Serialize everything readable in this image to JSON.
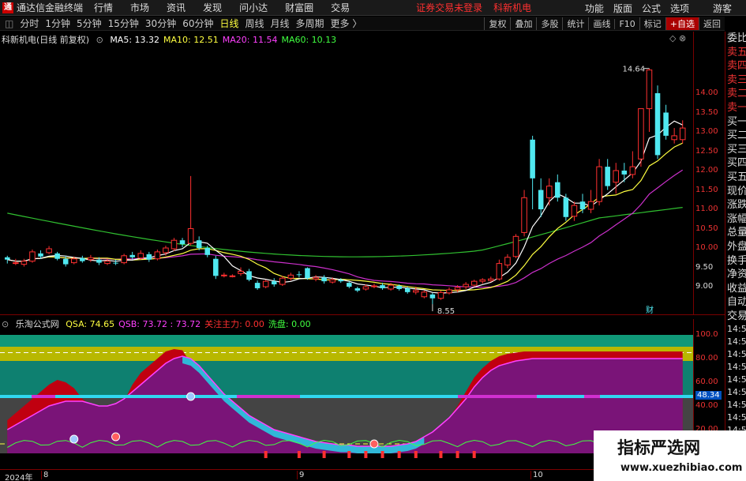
{
  "menubar": {
    "logo": "通",
    "app_title": "通达信金融终端",
    "items": [
      "行情",
      "市场",
      "资讯",
      "发现",
      "问小达",
      "财富圈",
      "交易"
    ],
    "warn": "证券交易未登录",
    "stock": "科新机电",
    "right": [
      "功能",
      "版面",
      "公式",
      "选项",
      "游客"
    ]
  },
  "periodbar": {
    "periods": [
      "分时",
      "1分钟",
      "5分钟",
      "15分钟",
      "30分钟",
      "60分钟",
      "日线",
      "周线",
      "月线",
      "多周期",
      "更多 〉"
    ],
    "active": "日线",
    "tools": [
      "复权",
      "叠加",
      "多股",
      "统计",
      "画线",
      "F10",
      "标记",
      "+自选",
      "返回"
    ]
  },
  "main": {
    "stock_label": "科新机电(日线 前复权)",
    "ma": [
      {
        "name": "MA5",
        "value": "13.32",
        "color": "#ffffff"
      },
      {
        "name": "MA10",
        "value": "12.51",
        "color": "#ffff40"
      },
      {
        "name": "MA20",
        "value": "11.54",
        "color": "#ff40ff"
      },
      {
        "name": "MA60",
        "value": "10.13",
        "color": "#40ff40"
      }
    ],
    "high_label": "14.64",
    "low_label": "8.55",
    "fin_mark": "财",
    "y_ticks": [
      "14.00",
      "13.50",
      "13.00",
      "12.50",
      "12.00",
      "11.50",
      "11.00",
      "10.50",
      "10.00",
      "9.50",
      "9.00"
    ]
  },
  "indicator": {
    "name": "乐淘公式网",
    "items": [
      {
        "text": "QSA: 74.65",
        "color": "#ffff40"
      },
      {
        "text": "QSB: 73.72 : 73.72",
        "color": "#ff40ff"
      },
      {
        "text": "关注主力: 0.00",
        "color": "#ff3030"
      },
      {
        "text": "洗盘: 0.00",
        "color": "#40ff40"
      }
    ],
    "y_ticks": [
      "100.0",
      "80.00",
      "60.00",
      "40.00",
      "20.00"
    ],
    "current": "48.34"
  },
  "dates": [
    "2024年",
    "8",
    "9",
    "10"
  ],
  "right_panel": {
    "labels": [
      "委比",
      "卖五",
      "卖四",
      "卖三",
      "卖二",
      "卖一",
      "买一",
      "买二",
      "买三",
      "买四",
      "买五",
      "现价",
      "涨跌",
      "涨幅",
      "总量",
      "外盘",
      "换手",
      "净资",
      "收益"
    ],
    "labels2": [
      "自动",
      "交易"
    ],
    "times": [
      "14:56",
      "14:56",
      "14:56",
      "14:56",
      "14:56",
      "14:56",
      "14:56",
      "14:56",
      "14:56",
      "14:56"
    ]
  },
  "watermark": {
    "line1": "指标严选网",
    "line2": "www.xuezhibiao.com"
  },
  "colors": {
    "up": "#ff3030",
    "down": "#50e8f0",
    "ma5": "#ffffff",
    "ma10": "#ffff40",
    "ma20": "#cc30cc",
    "ma60": "#30c030"
  },
  "candles": [
    [
      9.76,
      9.7,
      9.8,
      9.6
    ],
    [
      9.62,
      9.62,
      9.72,
      9.56
    ],
    [
      9.58,
      9.66,
      9.72,
      9.52
    ],
    [
      9.66,
      9.9,
      9.96,
      9.62
    ],
    [
      9.86,
      9.78,
      9.94,
      9.72
    ],
    [
      9.88,
      9.98,
      10.05,
      9.84
    ],
    [
      9.86,
      9.72,
      9.9,
      9.68
    ],
    [
      9.72,
      9.58,
      9.8,
      9.52
    ],
    [
      9.62,
      9.72,
      9.78,
      9.58
    ],
    [
      9.74,
      9.66,
      9.8,
      9.62
    ],
    [
      9.7,
      9.75,
      9.82,
      9.64
    ],
    [
      9.7,
      9.62,
      9.76,
      9.56
    ],
    [
      9.6,
      9.66,
      9.72,
      9.56
    ],
    [
      9.62,
      9.6,
      9.7,
      9.56
    ],
    [
      9.62,
      9.8,
      9.85,
      9.58
    ],
    [
      9.82,
      9.76,
      9.9,
      9.7
    ],
    [
      9.74,
      9.86,
      9.94,
      9.7
    ],
    [
      9.84,
      9.7,
      9.9,
      9.64
    ],
    [
      9.72,
      9.9,
      9.96,
      9.68
    ],
    [
      9.88,
      10.0,
      10.06,
      9.8
    ],
    [
      9.98,
      10.2,
      10.26,
      9.92
    ],
    [
      10.2,
      10.1,
      10.26,
      10.02
    ],
    [
      10.12,
      10.5,
      11.86,
      10.06
    ],
    [
      10.2,
      10.0,
      10.3,
      9.94
    ],
    [
      10.0,
      9.82,
      10.06,
      9.76
    ],
    [
      9.72,
      9.28,
      9.8,
      9.2
    ],
    [
      9.3,
      9.3,
      9.36,
      9.24
    ],
    [
      9.28,
      9.28,
      9.32,
      9.24
    ],
    [
      9.34,
      9.4,
      9.5,
      9.28
    ],
    [
      9.4,
      9.18,
      9.46,
      9.14
    ],
    [
      9.1,
      8.96,
      9.16,
      8.92
    ],
    [
      9.0,
      9.14,
      9.18,
      8.96
    ],
    [
      9.14,
      9.06,
      9.22,
      9.0
    ],
    [
      9.06,
      9.22,
      9.28,
      9.02
    ],
    [
      9.22,
      9.3,
      9.36,
      9.16
    ],
    [
      9.32,
      9.3,
      9.4,
      9.24
    ],
    [
      9.48,
      9.22,
      9.5,
      9.18
    ],
    [
      9.2,
      9.24,
      9.3,
      9.14
    ],
    [
      9.24,
      9.14,
      9.3,
      9.08
    ],
    [
      9.12,
      9.18,
      9.24,
      9.08
    ],
    [
      9.18,
      9.14,
      9.22,
      9.1
    ],
    [
      9.1,
      9.0,
      9.14,
      8.96
    ],
    [
      8.96,
      8.9,
      9.0,
      8.86
    ],
    [
      8.94,
      9.0,
      9.06,
      8.9
    ],
    [
      9.0,
      9.02,
      9.08,
      8.96
    ],
    [
      9.04,
      8.96,
      9.1,
      8.92
    ],
    [
      8.94,
      9.04,
      9.1,
      8.9
    ],
    [
      9.02,
      8.94,
      9.06,
      8.9
    ],
    [
      8.96,
      8.86,
      9.0,
      8.82
    ],
    [
      8.86,
      8.9,
      9.0,
      8.8
    ],
    [
      8.74,
      8.86,
      8.9,
      8.7
    ],
    [
      8.8,
      8.7,
      8.84,
      8.55
    ],
    [
      8.7,
      8.85,
      8.9,
      8.66
    ],
    [
      8.84,
      8.92,
      8.98,
      8.8
    ],
    [
      8.92,
      8.98,
      9.04,
      8.86
    ],
    [
      9.0,
      9.06,
      9.12,
      8.94
    ],
    [
      9.04,
      9.14,
      9.18,
      9.0
    ],
    [
      9.14,
      9.18,
      9.22,
      9.08
    ],
    [
      9.16,
      9.2,
      9.26,
      9.12
    ],
    [
      9.2,
      9.6,
      9.7,
      9.16
    ],
    [
      9.56,
      9.76,
      9.84,
      9.48
    ],
    [
      9.78,
      10.3,
      10.36,
      9.74
    ],
    [
      10.4,
      11.3,
      11.5,
      10.3
    ],
    [
      12.8,
      11.8,
      12.9,
      11.0
    ],
    [
      11.5,
      11.0,
      11.8,
      10.8
    ],
    [
      11.3,
      11.6,
      11.8,
      11.1
    ],
    [
      11.7,
      11.3,
      11.9,
      11.2
    ],
    [
      11.3,
      10.8,
      11.4,
      10.7
    ],
    [
      10.82,
      11.1,
      11.2,
      10.7
    ],
    [
      11.2,
      11.0,
      11.4,
      10.9
    ],
    [
      11.0,
      11.2,
      11.5,
      10.9
    ],
    [
      11.2,
      12.1,
      12.3,
      11.1
    ],
    [
      12.1,
      11.6,
      12.3,
      11.5
    ],
    [
      11.7,
      12.0,
      12.2,
      11.4
    ],
    [
      12.0,
      11.9,
      12.2,
      11.7
    ],
    [
      11.9,
      12.1,
      12.5,
      11.8
    ],
    [
      12.3,
      13.6,
      13.6,
      12.1
    ],
    [
      13.6,
      14.6,
      14.64,
      13.0
    ],
    [
      14.0,
      12.4,
      14.2,
      12.3
    ],
    [
      13.5,
      12.9,
      13.7,
      12.8
    ],
    [
      12.8,
      12.9,
      13.1,
      12.7
    ],
    [
      12.8,
      13.1,
      13.3,
      12.7
    ]
  ],
  "indicator_series": {
    "green_band": [
      [
        0.0,
        0.0
      ]
    ],
    "qsa": [
      28,
      34,
      40,
      46,
      52,
      58,
      62,
      60,
      55,
      46,
      40,
      36,
      34,
      38,
      44,
      58,
      68,
      74,
      80,
      86,
      88,
      87,
      76,
      68,
      58,
      48,
      40,
      34,
      28,
      22,
      18,
      15,
      13,
      12,
      11,
      10,
      9,
      8,
      7,
      6,
      6,
      5,
      5,
      4,
      4,
      4,
      4,
      5,
      6,
      8,
      12,
      17,
      22,
      30,
      40,
      52,
      64,
      72,
      78,
      82,
      84,
      85,
      86,
      86,
      86,
      86,
      86,
      86,
      86,
      86,
      86,
      86,
      86,
      86,
      86,
      86,
      86,
      86,
      86,
      86,
      86,
      86
    ],
    "qsb": [
      20,
      24,
      28,
      32,
      36,
      40,
      42,
      44,
      44,
      44,
      42,
      40,
      40,
      42,
      46,
      52,
      58,
      64,
      70,
      76,
      80,
      82,
      80,
      74,
      66,
      58,
      50,
      44,
      38,
      32,
      28,
      24,
      20,
      18,
      16,
      14,
      12,
      10,
      9,
      8,
      7,
      7,
      6,
      6,
      6,
      6,
      6,
      7,
      8,
      10,
      14,
      18,
      24,
      30,
      38,
      46,
      56,
      64,
      70,
      74,
      76,
      78,
      79,
      80,
      80,
      80,
      80,
      80,
      80,
      80,
      80,
      80,
      80,
      80,
      80,
      80,
      80,
      80,
      80,
      80,
      80,
      80
    ]
  }
}
